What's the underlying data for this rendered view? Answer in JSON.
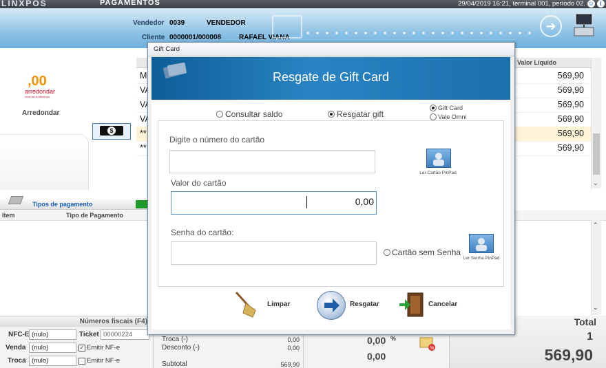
{
  "app": {
    "brand": "LINXPOS",
    "module": "PAGAMENTOS",
    "status_info": "29/04/2019 16:21, terminal 001, período 02."
  },
  "header": {
    "vendedor_label": "Vendedor",
    "vendedor_code": "0039",
    "vendedor_name": "VENDEDOR",
    "cliente_label": "Cliente",
    "cliente_code": "0000001/000008",
    "cliente_name": "RAFAEL VIANA"
  },
  "left_panel": {
    "logo_value": ",00",
    "logo_text": "arredondar",
    "logo_sub": "você faz a diferença",
    "round_label": "Arredondar"
  },
  "items_list": {
    "column_net_value": "Valor Líquido",
    "rows": [
      {
        "prefix": "MU",
        "value": "569,90",
        "highlight": false
      },
      {
        "prefix": "VA",
        "value": "569,90",
        "highlight": false
      },
      {
        "prefix": "VA",
        "value": "569,90",
        "highlight": false
      },
      {
        "prefix": "VA",
        "value": "569,90",
        "highlight": false
      },
      {
        "prefix": "**",
        "value": "569,90",
        "highlight": true
      },
      {
        "prefix": "**",
        "value": "569,90",
        "highlight": false
      }
    ]
  },
  "payment_section": {
    "title": "Tipos de pagamento",
    "col_item": "Item",
    "col_type": "Tipo de Pagamento"
  },
  "fiscal": {
    "header": "Números fiscais (F4)",
    "nfce_label": "NFC-E",
    "nfce_value": "(nulo)",
    "ticket_label": "Ticket",
    "ticket_value": "00000224",
    "venda_label": "Venda",
    "venda_value": "(nulo)",
    "emitir_nfe_1": "Emitir NF-e",
    "troca_label": "Troca",
    "troca_value": "(nulo)",
    "emitir_nfe_2": "Emitir NF-e"
  },
  "summary": {
    "troca_label": "Troca (-)",
    "troca_value": "0,00",
    "desconto_label": "Desconto (-)",
    "desconto_value": "0,00",
    "subtotal_label": "Subtotal",
    "subtotal_value": "569,90",
    "pct_value": "0,00",
    "pct_symbol": "%",
    "value2": "0,00",
    "total_label": "Total",
    "total_count": "1",
    "total_value": "569,90"
  },
  "modal": {
    "title": "Gift Card",
    "banner": "Resgate de Gift Card",
    "radio_consultar": "Consultar saldo",
    "radio_resgatar": "Resgatar gift",
    "radio_gift_card": "Gift Card",
    "radio_vale_omni": "Vale Omni",
    "card_number_label": "Digite o número do cartão",
    "card_number_value": "",
    "card_value_label": "Valor do cartão",
    "card_value_value": "0,00",
    "password_label": "Senha do cartão:",
    "password_value": "",
    "no_password_label": "Cartão sem Senha",
    "read_card_pinpad": "Ler Cartão PinPad",
    "read_password_pinpad": "Ler Senha PinPad",
    "btn_limpar": "Limpar",
    "btn_resgatar": "Resgatar",
    "btn_cancelar": "Cancelar"
  },
  "colors": {
    "banner_blue": "#1b6fae",
    "header_blue": "#8fc3e6",
    "highlight_row": "#fdf3d6",
    "payment_green": "#1e9a2a",
    "logo_orange": "#f39200"
  }
}
